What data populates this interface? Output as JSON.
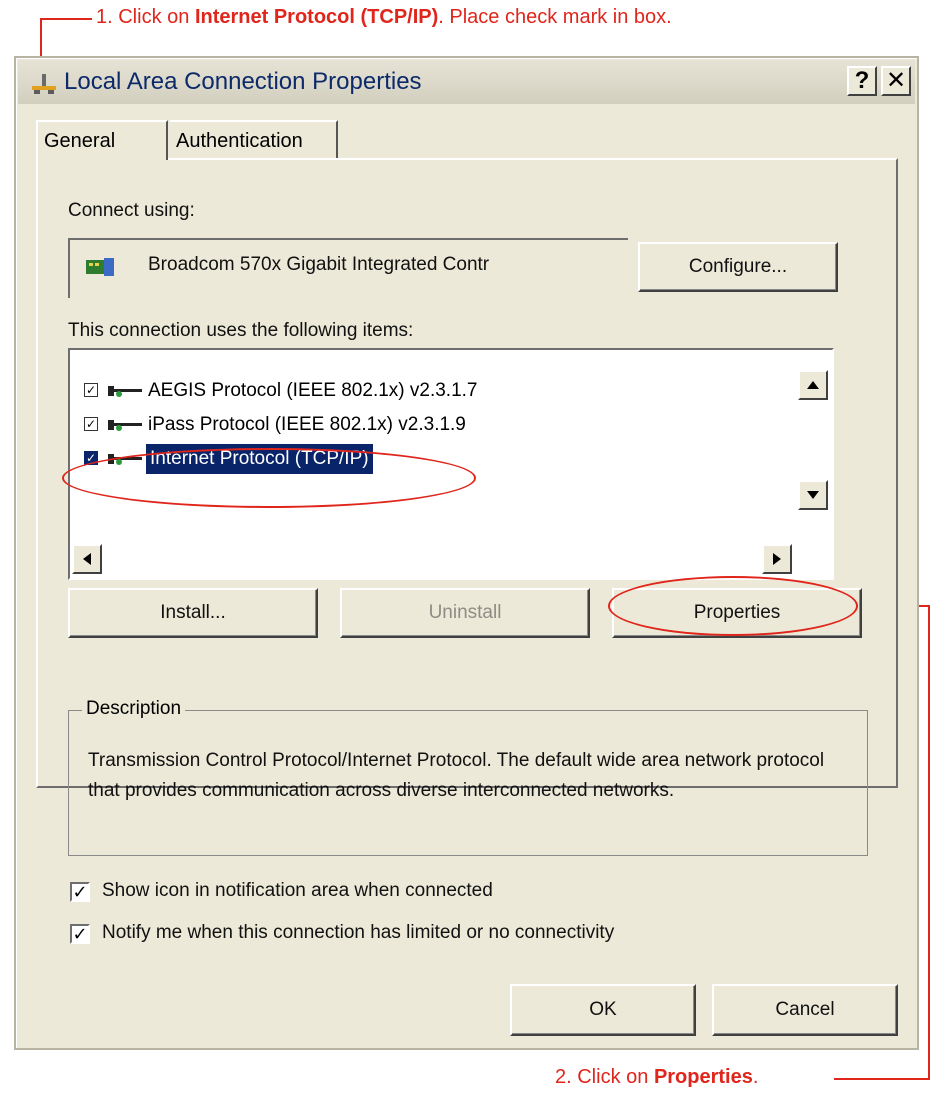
{
  "annotations": {
    "step1_prefix": "1. Click on ",
    "step1_bold": "Internet Protocol (TCP/IP)",
    "step1_suffix": ". Place check mark in box.",
    "step2_prefix": "2. Click on ",
    "step2_bold": "Properties",
    "step2_suffix": ".",
    "color": "#e0251b"
  },
  "window": {
    "title": "Local Area Connection Properties",
    "help_btn": "?",
    "close_btn": "✕"
  },
  "tabs": [
    {
      "label": "General",
      "active": true
    },
    {
      "label": "Authentication",
      "active": false
    }
  ],
  "connect": {
    "label": "Connect using:",
    "adapter": "Broadcom 570x Gigabit Integrated Contr",
    "configure_btn": "Configure..."
  },
  "items": {
    "label": "This connection uses the following items:",
    "list": [
      {
        "label": "AEGIS Protocol (IEEE 802.1x) v2.3.1.7",
        "checked": true
      },
      {
        "label": "iPass Protocol (IEEE 802.1x) v2.3.1.9",
        "checked": true
      },
      {
        "label": "Internet Protocol (TCP/IP)",
        "checked": true,
        "selected": true
      }
    ]
  },
  "buttons": {
    "install": "Install...",
    "uninstall": "Uninstall",
    "properties": "Properties",
    "ok": "OK",
    "cancel": "Cancel"
  },
  "description": {
    "title": "Description",
    "text": "Transmission Control Protocol/Internet Protocol. The default wide area network protocol that provides communication across diverse interconnected networks."
  },
  "options": {
    "show_icon": "Show icon in notification area when connected",
    "notify": "Notify me when this connection has limited or no connectivity"
  }
}
